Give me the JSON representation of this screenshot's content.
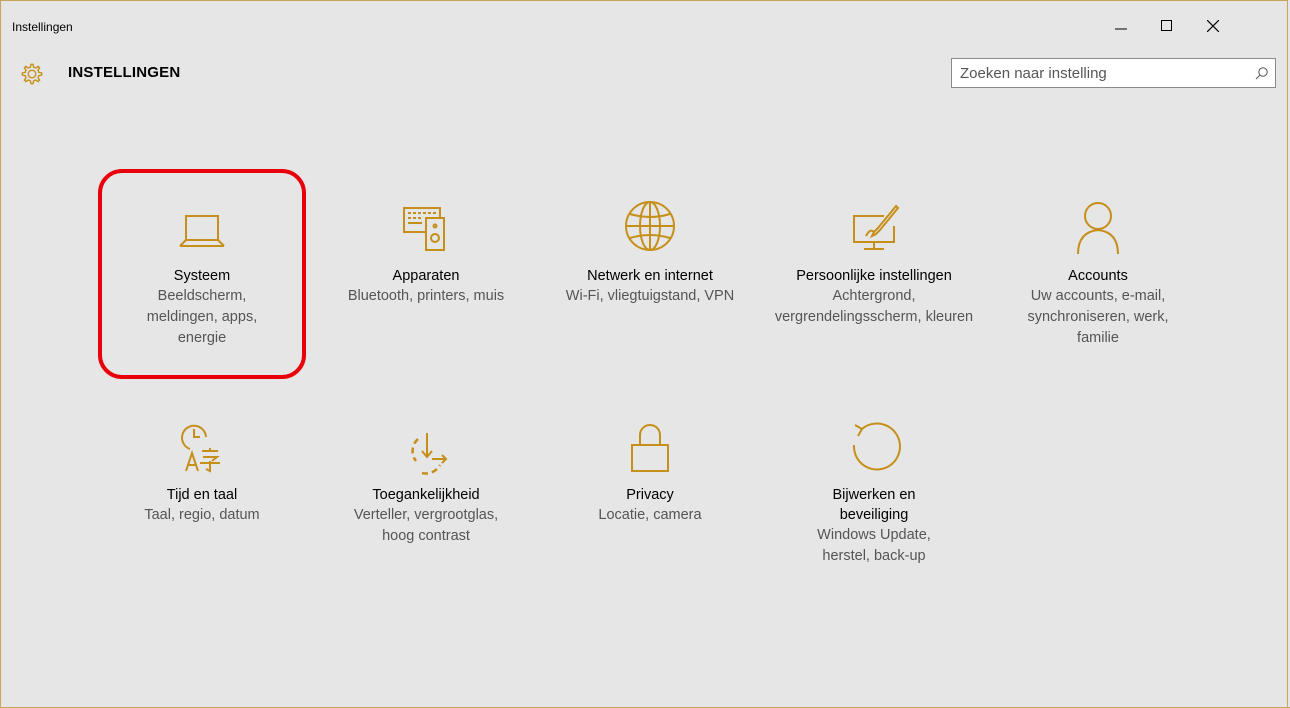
{
  "window": {
    "title": "Instellingen"
  },
  "header": {
    "title": "INSTELLINGEN",
    "search_placeholder": "Zoeken naar instelling"
  },
  "colors": {
    "accent": "#c58f1a",
    "highlight": "#e8000b",
    "background": "#e6e6e6"
  },
  "tiles": [
    {
      "icon": "laptop-icon",
      "title": "Systeem",
      "desc": "Beeldscherm, meldingen, apps, energie",
      "highlighted": true
    },
    {
      "icon": "devices-icon",
      "title": "Apparaten",
      "desc": "Bluetooth, printers, muis"
    },
    {
      "icon": "globe-icon",
      "title": "Netwerk en internet",
      "desc": "Wi-Fi, vliegtuigstand, VPN"
    },
    {
      "icon": "personalization-icon",
      "title": "Persoonlijke instellingen",
      "desc": "Achtergrond, vergrendelingsscherm, kleuren"
    },
    {
      "icon": "person-icon",
      "title": "Accounts",
      "desc": "Uw accounts, e-mail, synchroniseren, werk, familie"
    },
    {
      "icon": "time-language-icon",
      "title": "Tijd en taal",
      "desc": "Taal, regio, datum"
    },
    {
      "icon": "ease-of-access-icon",
      "title": "Toegankelijkheid",
      "desc": "Verteller, vergrootglas, hoog contrast"
    },
    {
      "icon": "lock-icon",
      "title": "Privacy",
      "desc": "Locatie, camera"
    },
    {
      "icon": "update-icon",
      "title": "Bijwerken en beveiliging",
      "desc": "Windows Update, herstel, back-up"
    }
  ]
}
